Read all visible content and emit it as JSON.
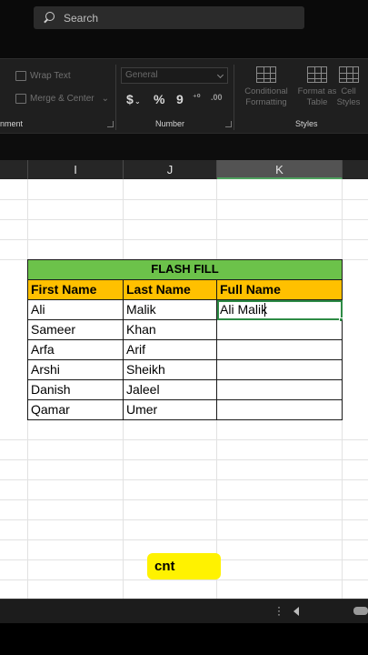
{
  "search": {
    "placeholder": "Search"
  },
  "ribbon": {
    "alignment": {
      "wrap_text": "Wrap Text",
      "merge_center": "Merge & Center",
      "group_label": "nment"
    },
    "number": {
      "format_value": "General",
      "currency": "$",
      "percent": "%",
      "comma": "9",
      "group_label": "Number"
    },
    "styles": {
      "conditional": [
        "Conditional",
        "Formatting"
      ],
      "format_as_table": [
        "Format as",
        "Table"
      ],
      "cell_styles": [
        "Cell",
        "Styles"
      ],
      "group_label": "Styles"
    }
  },
  "columns": [
    "I",
    "J",
    "K"
  ],
  "table": {
    "title": "FLASH FILL",
    "headers": [
      "First Name",
      "Last Name",
      "Full Name"
    ],
    "rows": [
      [
        "Ali",
        "Malik",
        "Ali Malik"
      ],
      [
        "Sameer",
        "Khan",
        ""
      ],
      [
        "Arfa",
        "Arif",
        ""
      ],
      [
        "Arshi",
        "Sheikh",
        ""
      ],
      [
        "Danish",
        "Jaleel",
        ""
      ],
      [
        "Qamar",
        "Umer",
        ""
      ]
    ]
  },
  "overlay": {
    "badge_text": "cnt"
  },
  "colors": {
    "title_green": "#6cc24a",
    "header_yellow": "#ffc000",
    "badge_yellow": "#fff200",
    "selection_green": "#2e8b45"
  }
}
